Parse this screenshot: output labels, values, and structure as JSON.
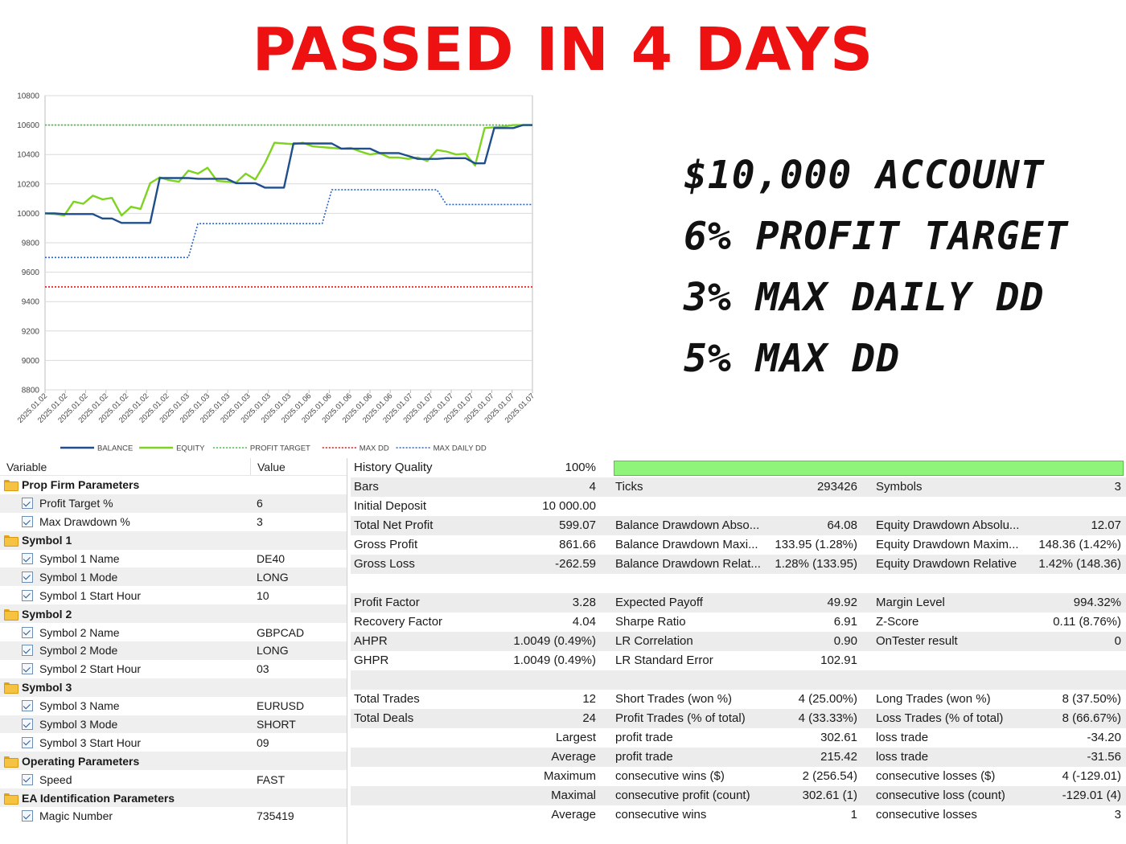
{
  "headline": "PASSED IN 4 DAYS",
  "account_stats": [
    "$10,000 ACCOUNT",
    "6% PROFIT TARGET",
    "3% MAX DAILY DD",
    "5% MAX DD"
  ],
  "chart_data": {
    "type": "line",
    "title": "",
    "xlabel": "",
    "ylabel": "",
    "ylim": [
      8800,
      10800
    ],
    "y_ticks": [
      8800,
      9000,
      9200,
      9400,
      9600,
      9800,
      10000,
      10200,
      10400,
      10600,
      10800
    ],
    "x_tick_labels": [
      "2025.01.02",
      "2025.01.02",
      "2025.01.02",
      "2025.01.02",
      "2025.01.02",
      "2025.01.02",
      "2025.01.02",
      "2025.01.03",
      "2025.01.03",
      "2025.01.03",
      "2025.01.03",
      "2025.01.03",
      "2025.01.03",
      "2025.01.06",
      "2025.01.06",
      "2025.01.06",
      "2025.01.06",
      "2025.01.06",
      "2025.01.07",
      "2025.01.07",
      "2025.01.07",
      "2025.01.07",
      "2025.01.07",
      "2025.01.07",
      "2025.01.07"
    ],
    "grid": "horizontal",
    "legend_position": "bottom",
    "series": [
      {
        "name": "BALANCE",
        "color": "#1f4e8c",
        "style": "solid",
        "values": [
          10000,
          10000,
          9995,
          9995,
          9995,
          9995,
          9965,
          9965,
          9935,
          9935,
          9935,
          9935,
          10240,
          10240,
          10240,
          10240,
          10235,
          10235,
          10235,
          10235,
          10205,
          10205,
          10205,
          10175,
          10175,
          10175,
          10475,
          10475,
          10475,
          10475,
          10475,
          10440,
          10440,
          10440,
          10440,
          10410,
          10410,
          10410,
          10390,
          10370,
          10370,
          10370,
          10375,
          10375,
          10375,
          10340,
          10340,
          10580,
          10580,
          10580,
          10600,
          10600
        ]
      },
      {
        "name": "EQUITY",
        "color": "#7ed321",
        "style": "solid",
        "values": [
          10000,
          9995,
          9985,
          10080,
          10065,
          10120,
          10095,
          10105,
          9985,
          10045,
          10030,
          10205,
          10245,
          10225,
          10215,
          10290,
          10270,
          10310,
          10220,
          10215,
          10210,
          10270,
          10230,
          10340,
          10480,
          10475,
          10470,
          10480,
          10455,
          10450,
          10445,
          10440,
          10445,
          10420,
          10400,
          10410,
          10380,
          10380,
          10370,
          10380,
          10355,
          10430,
          10420,
          10400,
          10405,
          10325,
          10580,
          10585,
          10590,
          10600,
          10600,
          10600
        ]
      },
      {
        "name": "PROFIT TARGET",
        "color": "#3fbf3f",
        "style": "dotted",
        "values": [
          10600,
          10600
        ]
      },
      {
        "name": "MAX DD",
        "color": "#e01414",
        "style": "dotted",
        "values": [
          9500,
          9500
        ]
      },
      {
        "name": "MAX DAILY DD",
        "color": "#2a63c2",
        "style": "dotted",
        "values": [
          9700,
          9700,
          9700,
          9700,
          9700,
          9700,
          9700,
          9700,
          9700,
          9700,
          9700,
          9700,
          9700,
          9700,
          9700,
          9700,
          9930,
          9930,
          9930,
          9930,
          9930,
          9930,
          9930,
          9930,
          9930,
          9930,
          9930,
          9930,
          9930,
          9930,
          10160,
          10160,
          10160,
          10160,
          10160,
          10160,
          10160,
          10160,
          10160,
          10160,
          10160,
          10160,
          10060,
          10060,
          10060,
          10060,
          10060,
          10060,
          10060,
          10060,
          10060,
          10060
        ]
      }
    ]
  },
  "inputs": {
    "columns": [
      "Variable",
      "Value"
    ],
    "rows": [
      {
        "type": "group",
        "name": "Prop Firm Parameters",
        "value": ""
      },
      {
        "type": "param",
        "name": "Profit Target %",
        "value": "6"
      },
      {
        "type": "param",
        "name": "Max Drawdown %",
        "value": "3"
      },
      {
        "type": "group",
        "name": "Symbol 1",
        "value": ""
      },
      {
        "type": "param",
        "name": "Symbol 1 Name",
        "value": "DE40"
      },
      {
        "type": "param",
        "name": "Symbol 1 Mode",
        "value": "LONG"
      },
      {
        "type": "param",
        "name": "Symbol 1 Start Hour",
        "value": "10"
      },
      {
        "type": "group",
        "name": "Symbol 2",
        "value": ""
      },
      {
        "type": "param",
        "name": "Symbol 2 Name",
        "value": "GBPCAD"
      },
      {
        "type": "param",
        "name": "Symbol 2 Mode",
        "value": "LONG"
      },
      {
        "type": "param",
        "name": "Symbol 2 Start Hour",
        "value": "03"
      },
      {
        "type": "group",
        "name": "Symbol 3",
        "value": ""
      },
      {
        "type": "param",
        "name": "Symbol 3 Name",
        "value": "EURUSD"
      },
      {
        "type": "param",
        "name": "Symbol 3 Mode",
        "value": "SHORT"
      },
      {
        "type": "param",
        "name": "Symbol 3 Start Hour",
        "value": "09"
      },
      {
        "type": "group",
        "name": "Operating Parameters",
        "value": ""
      },
      {
        "type": "param",
        "name": "Speed",
        "value": "FAST"
      },
      {
        "type": "group",
        "name": "EA Identification Parameters",
        "value": ""
      },
      {
        "type": "param",
        "name": "Magic Number",
        "value": "735419"
      }
    ]
  },
  "results": {
    "history_quality": {
      "label": "History Quality",
      "value": "100%",
      "fill": 1.0
    },
    "rows": [
      {
        "c": [
          "Bars",
          "4",
          "Ticks",
          "293426",
          "Symbols",
          "3"
        ]
      },
      {
        "c": [
          "Initial Deposit",
          "10 000.00",
          "",
          "",
          "",
          ""
        ]
      },
      {
        "c": [
          "Total Net Profit",
          "599.07",
          "Balance Drawdown Abso...",
          "64.08",
          "Equity Drawdown Absolu...",
          "12.07"
        ]
      },
      {
        "c": [
          "Gross Profit",
          "861.66",
          "Balance Drawdown Maxi...",
          "133.95 (1.28%)",
          "Equity Drawdown Maxim...",
          "148.36 (1.42%)"
        ]
      },
      {
        "c": [
          "Gross Loss",
          "-262.59",
          "Balance Drawdown Relat...",
          "1.28% (133.95)",
          "Equity Drawdown Relative",
          "1.42% (148.36)"
        ]
      },
      {
        "c": [
          "",
          "",
          "",
          "",
          "",
          ""
        ]
      },
      {
        "c": [
          "Profit Factor",
          "3.28",
          "Expected Payoff",
          "49.92",
          "Margin Level",
          "994.32%"
        ]
      },
      {
        "c": [
          "Recovery Factor",
          "4.04",
          "Sharpe Ratio",
          "6.91",
          "Z-Score",
          "0.11 (8.76%)"
        ]
      },
      {
        "c": [
          "AHPR",
          "1.0049 (0.49%)",
          "LR Correlation",
          "0.90",
          "OnTester result",
          "0"
        ]
      },
      {
        "c": [
          "GHPR",
          "1.0049 (0.49%)",
          "LR Standard Error",
          "102.91",
          "",
          ""
        ]
      },
      {
        "c": [
          "",
          "",
          "",
          "",
          "",
          ""
        ]
      },
      {
        "c": [
          "Total Trades",
          "12",
          "Short Trades (won %)",
          "4 (25.00%)",
          "Long Trades (won %)",
          "8 (37.50%)"
        ]
      },
      {
        "c": [
          "Total Deals",
          "24",
          "Profit Trades (% of total)",
          "4 (33.33%)",
          "Loss Trades (% of total)",
          "8 (66.67%)"
        ]
      },
      {
        "c": [
          "",
          "Largest",
          "profit trade",
          "302.61",
          "loss trade",
          "-34.20"
        ]
      },
      {
        "c": [
          "",
          "Average",
          "profit trade",
          "215.42",
          "loss trade",
          "-31.56"
        ]
      },
      {
        "c": [
          "",
          "Maximum",
          "consecutive wins ($)",
          "2 (256.54)",
          "consecutive losses ($)",
          "4 (-129.01)"
        ]
      },
      {
        "c": [
          "",
          "Maximal",
          "consecutive profit (count)",
          "302.61 (1)",
          "consecutive loss (count)",
          "-129.01 (4)"
        ]
      },
      {
        "c": [
          "",
          "Average",
          "consecutive wins",
          "1",
          "consecutive losses",
          "3"
        ]
      }
    ]
  }
}
